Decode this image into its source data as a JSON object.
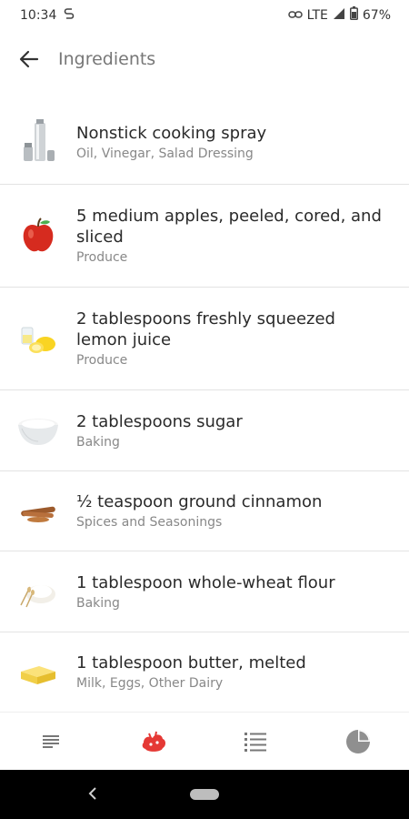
{
  "status_bar": {
    "time": "10:34",
    "network": "LTE",
    "battery": "67%"
  },
  "app_bar": {
    "title": "Ingredients"
  },
  "ingredients": [
    {
      "name": "Nonstick cooking spray",
      "category": "Oil, Vinegar, Salad Dressing",
      "icon": "cooking-spray-icon"
    },
    {
      "name": "5 medium apples, peeled, cored, and sliced",
      "category": "Produce",
      "icon": "apple-icon"
    },
    {
      "name": "2 tablespoons freshly squeezed lemon juice",
      "category": "Produce",
      "icon": "lemon-icon"
    },
    {
      "name": "2 tablespoons sugar",
      "category": "Baking",
      "icon": "sugar-bowl-icon"
    },
    {
      "name": "½ teaspoon ground cinnamon",
      "category": "Spices and Seasonings",
      "icon": "cinnamon-icon"
    },
    {
      "name": "1 tablespoon whole-wheat flour",
      "category": "Baking",
      "icon": "flour-icon"
    },
    {
      "name": "1 tablespoon butter, melted",
      "category": "Milk, Eggs, Other Dairy",
      "icon": "butter-icon"
    }
  ],
  "bottom_nav": {
    "active": "ingredients",
    "accent_color": "#e53935",
    "items": [
      "overview-icon",
      "ingredients-icon",
      "directions-icon",
      "nutrition-icon"
    ]
  }
}
